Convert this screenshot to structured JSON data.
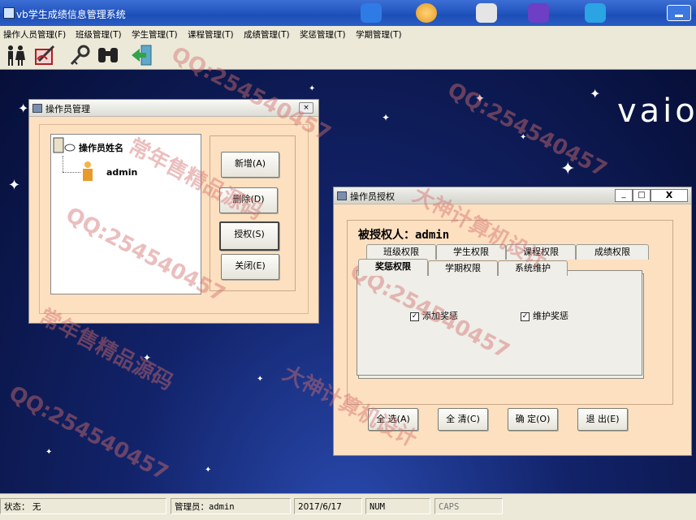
{
  "app": {
    "title": "vb学生成绩信息管理系统"
  },
  "menu": [
    "操作人员管理(F)",
    "班级管理(T)",
    "学生管理(T)",
    "课程管理(T)",
    "成绩管理(T)",
    "奖惩管理(T)",
    "学期管理(T)"
  ],
  "toolbar": {
    "icons": [
      "operators-icon",
      "edit-icon",
      "search-key-icon",
      "binoculars-icon",
      "exit-icon"
    ]
  },
  "desktop": {
    "logo": "vaio"
  },
  "operator_window": {
    "title": "操作员管理",
    "tree_root": "操作员姓名",
    "tree_items": [
      "admin"
    ],
    "buttons": {
      "add": "新增(A)",
      "delete": "删除(D)",
      "authorize": "授权(S)",
      "close": "关闭(E)"
    }
  },
  "auth_window": {
    "title": "操作员授权",
    "header": "被授权人：admin",
    "tabs_row1": [
      "班级权限",
      "学生权限",
      "课程权限",
      "成绩权限"
    ],
    "tabs_row2": [
      "奖惩权限",
      "学期权限",
      "系统维护"
    ],
    "active_tab": "奖惩权限",
    "checkboxes": [
      {
        "label": "添加奖惩",
        "checked": true
      },
      {
        "label": "维护奖惩",
        "checked": true
      }
    ],
    "buttons": {
      "select_all": "全 选(A)",
      "clear_all": "全 清(C)",
      "ok": "确 定(O)",
      "exit": "退 出(E)"
    },
    "controls": {
      "min": "_",
      "max": "□",
      "close": "X"
    }
  },
  "statusbar": {
    "status": "状态： 无",
    "operator": "管理员：admin",
    "date": "2017/6/17",
    "num": "NUM",
    "caps": "CAPS"
  },
  "watermarks": [
    "QQ:254540457",
    "常年售精品源码",
    "大神计算机设计"
  ]
}
